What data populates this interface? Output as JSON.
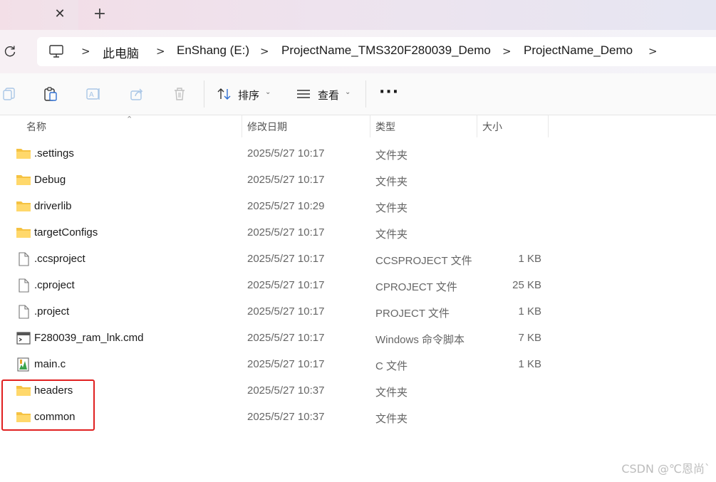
{
  "tab": {
    "close_symbol": "✕",
    "new_tab_symbol": "+"
  },
  "breadcrumb": {
    "items": [
      "此电脑",
      "EnShang (E:)",
      "ProjectName_TMS320F280039_Demo",
      "ProjectName_Demo"
    ],
    "separator": ">"
  },
  "toolbar": {
    "sort_label": "排序",
    "view_label": "查看",
    "more_label": "···"
  },
  "columns": {
    "name": "名称",
    "modified": "修改日期",
    "type": "类型",
    "size": "大小"
  },
  "files": [
    {
      "name": ".settings",
      "modified": "2025/5/27 10:17",
      "type": "文件夹",
      "size": "",
      "icon": "folder-icon"
    },
    {
      "name": "Debug",
      "modified": "2025/5/27 10:17",
      "type": "文件夹",
      "size": "",
      "icon": "folder-icon"
    },
    {
      "name": "driverlib",
      "modified": "2025/5/27 10:29",
      "type": "文件夹",
      "size": "",
      "icon": "folder-icon"
    },
    {
      "name": "targetConfigs",
      "modified": "2025/5/27 10:17",
      "type": "文件夹",
      "size": "",
      "icon": "folder-icon"
    },
    {
      "name": ".ccsproject",
      "modified": "2025/5/27 10:17",
      "type": "CCSPROJECT 文件",
      "size": "1 KB",
      "icon": "file-icon"
    },
    {
      "name": ".cproject",
      "modified": "2025/5/27 10:17",
      "type": "CPROJECT 文件",
      "size": "25 KB",
      "icon": "file-icon"
    },
    {
      "name": ".project",
      "modified": "2025/5/27 10:17",
      "type": "PROJECT 文件",
      "size": "1 KB",
      "icon": "file-icon"
    },
    {
      "name": "F280039_ram_lnk.cmd",
      "modified": "2025/5/27 10:17",
      "type": "Windows 命令脚本",
      "size": "7 KB",
      "icon": "cmd-file-icon"
    },
    {
      "name": "main.c",
      "modified": "2025/5/27 10:17",
      "type": "C 文件",
      "size": "1 KB",
      "icon": "c-file-icon"
    },
    {
      "name": "headers",
      "modified": "2025/5/27 10:37",
      "type": "文件夹",
      "size": "",
      "icon": "folder-icon"
    },
    {
      "name": "common",
      "modified": "2025/5/27 10:37",
      "type": "文件夹",
      "size": "",
      "icon": "folder-icon"
    }
  ],
  "watermark": "CSDN @℃恩尚`",
  "colors": {
    "highlight": "#e02020",
    "folder": "#f5c242"
  }
}
